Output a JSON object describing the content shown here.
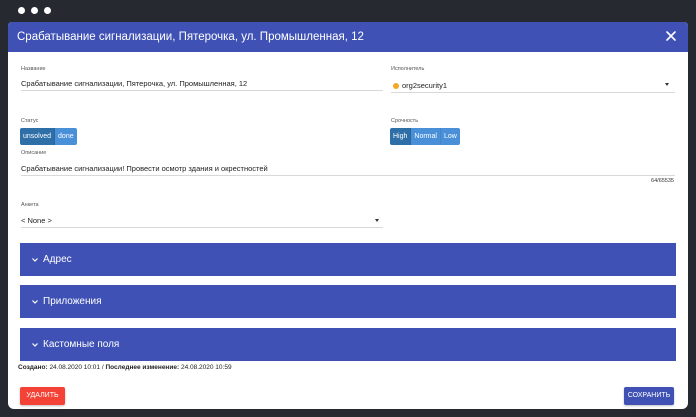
{
  "dialog": {
    "title": "Срабатывание сигнализации, Пятерочка, ул. Промышленная, 12"
  },
  "fields": {
    "name_label": "Название",
    "name_value": "Срабатывание сигнализации, Пятерочка, ул. Промышленная, 12",
    "executor_label": "Исполнитель",
    "executor_value": "org2security1",
    "status_label": "Статус",
    "status_options": [
      "unsolved",
      "done"
    ],
    "urgency_label": "Срочность",
    "urgency_options": [
      "High",
      "Normal",
      "Low"
    ],
    "description_label": "Описание",
    "description_value": "Срабатывание сигнализации! Провести осмотр здания и окрестностей",
    "description_counter": "64/65535",
    "form_label": "Анкета",
    "form_value": "< None >"
  },
  "sections": [
    "Адрес",
    "Приложения",
    "Кастомные поля"
  ],
  "meta": {
    "created_label": "Создано:",
    "created_value": "24.08.2020 10:01",
    "separator": "/",
    "modified_label": "Последнее изменение:",
    "modified_value": "24.08.2020 10:59"
  },
  "buttons": {
    "delete": "УДАЛИТЬ",
    "save": "СОХРАНИТЬ"
  },
  "colors": {
    "primary": "#3f51b5",
    "toggle": "#4a90d9",
    "danger": "#f44336",
    "status_dot": "#f5a623"
  }
}
